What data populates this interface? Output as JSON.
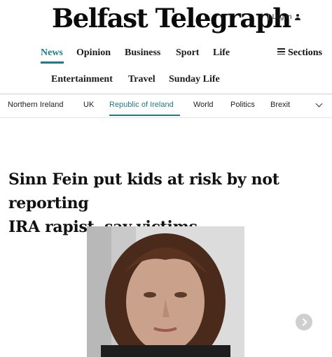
{
  "site": {
    "logo": "Belfast Telegraph",
    "login_label": "Log In",
    "separator": "|"
  },
  "nav": {
    "items": [
      "News",
      "Opinion",
      "Business",
      "Sport",
      "Life",
      "Entertainment",
      "Travel",
      "Sunday Life"
    ],
    "sections_label": "Sections",
    "active": "News"
  },
  "subnav": {
    "items": [
      "Northern Ireland",
      "UK",
      "Republic of Ireland",
      "World",
      "Politics",
      "Brexit"
    ],
    "active": "Republic of Ireland"
  },
  "article": {
    "headline_line1": "Sinn Fein put kids at risk by not reporting",
    "headline_line2": "IRA rapist, say victims"
  },
  "colors": {
    "accent": "#1f7a8a"
  }
}
